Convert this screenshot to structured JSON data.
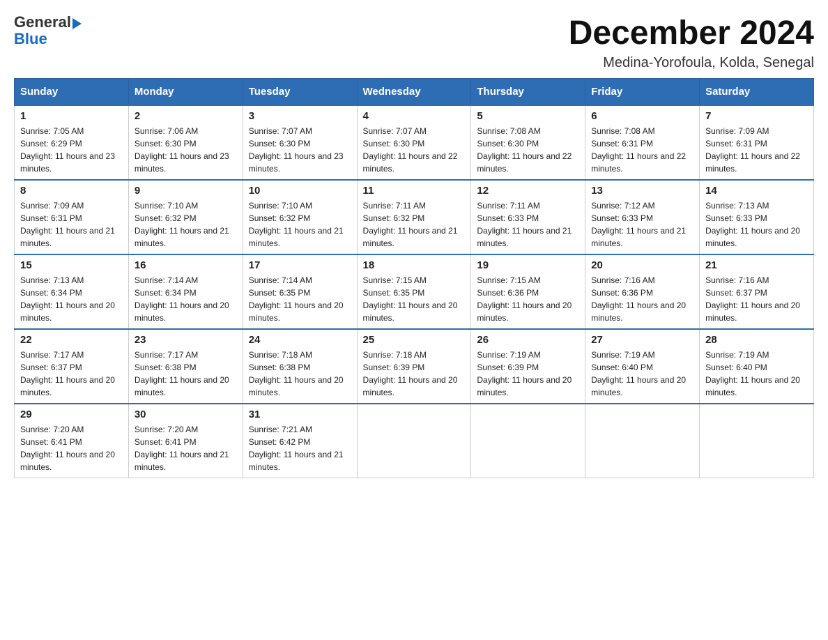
{
  "logo": {
    "text_general": "General",
    "text_blue": "Blue"
  },
  "header": {
    "month_title": "December 2024",
    "location": "Medina-Yorofoula, Kolda, Senegal"
  },
  "days_of_week": [
    "Sunday",
    "Monday",
    "Tuesday",
    "Wednesday",
    "Thursday",
    "Friday",
    "Saturday"
  ],
  "weeks": [
    [
      {
        "day": "1",
        "sunrise": "7:05 AM",
        "sunset": "6:29 PM",
        "daylight": "11 hours and 23 minutes."
      },
      {
        "day": "2",
        "sunrise": "7:06 AM",
        "sunset": "6:30 PM",
        "daylight": "11 hours and 23 minutes."
      },
      {
        "day": "3",
        "sunrise": "7:07 AM",
        "sunset": "6:30 PM",
        "daylight": "11 hours and 23 minutes."
      },
      {
        "day": "4",
        "sunrise": "7:07 AM",
        "sunset": "6:30 PM",
        "daylight": "11 hours and 22 minutes."
      },
      {
        "day": "5",
        "sunrise": "7:08 AM",
        "sunset": "6:30 PM",
        "daylight": "11 hours and 22 minutes."
      },
      {
        "day": "6",
        "sunrise": "7:08 AM",
        "sunset": "6:31 PM",
        "daylight": "11 hours and 22 minutes."
      },
      {
        "day": "7",
        "sunrise": "7:09 AM",
        "sunset": "6:31 PM",
        "daylight": "11 hours and 22 minutes."
      }
    ],
    [
      {
        "day": "8",
        "sunrise": "7:09 AM",
        "sunset": "6:31 PM",
        "daylight": "11 hours and 21 minutes."
      },
      {
        "day": "9",
        "sunrise": "7:10 AM",
        "sunset": "6:32 PM",
        "daylight": "11 hours and 21 minutes."
      },
      {
        "day": "10",
        "sunrise": "7:10 AM",
        "sunset": "6:32 PM",
        "daylight": "11 hours and 21 minutes."
      },
      {
        "day": "11",
        "sunrise": "7:11 AM",
        "sunset": "6:32 PM",
        "daylight": "11 hours and 21 minutes."
      },
      {
        "day": "12",
        "sunrise": "7:11 AM",
        "sunset": "6:33 PM",
        "daylight": "11 hours and 21 minutes."
      },
      {
        "day": "13",
        "sunrise": "7:12 AM",
        "sunset": "6:33 PM",
        "daylight": "11 hours and 21 minutes."
      },
      {
        "day": "14",
        "sunrise": "7:13 AM",
        "sunset": "6:33 PM",
        "daylight": "11 hours and 20 minutes."
      }
    ],
    [
      {
        "day": "15",
        "sunrise": "7:13 AM",
        "sunset": "6:34 PM",
        "daylight": "11 hours and 20 minutes."
      },
      {
        "day": "16",
        "sunrise": "7:14 AM",
        "sunset": "6:34 PM",
        "daylight": "11 hours and 20 minutes."
      },
      {
        "day": "17",
        "sunrise": "7:14 AM",
        "sunset": "6:35 PM",
        "daylight": "11 hours and 20 minutes."
      },
      {
        "day": "18",
        "sunrise": "7:15 AM",
        "sunset": "6:35 PM",
        "daylight": "11 hours and 20 minutes."
      },
      {
        "day": "19",
        "sunrise": "7:15 AM",
        "sunset": "6:36 PM",
        "daylight": "11 hours and 20 minutes."
      },
      {
        "day": "20",
        "sunrise": "7:16 AM",
        "sunset": "6:36 PM",
        "daylight": "11 hours and 20 minutes."
      },
      {
        "day": "21",
        "sunrise": "7:16 AM",
        "sunset": "6:37 PM",
        "daylight": "11 hours and 20 minutes."
      }
    ],
    [
      {
        "day": "22",
        "sunrise": "7:17 AM",
        "sunset": "6:37 PM",
        "daylight": "11 hours and 20 minutes."
      },
      {
        "day": "23",
        "sunrise": "7:17 AM",
        "sunset": "6:38 PM",
        "daylight": "11 hours and 20 minutes."
      },
      {
        "day": "24",
        "sunrise": "7:18 AM",
        "sunset": "6:38 PM",
        "daylight": "11 hours and 20 minutes."
      },
      {
        "day": "25",
        "sunrise": "7:18 AM",
        "sunset": "6:39 PM",
        "daylight": "11 hours and 20 minutes."
      },
      {
        "day": "26",
        "sunrise": "7:19 AM",
        "sunset": "6:39 PM",
        "daylight": "11 hours and 20 minutes."
      },
      {
        "day": "27",
        "sunrise": "7:19 AM",
        "sunset": "6:40 PM",
        "daylight": "11 hours and 20 minutes."
      },
      {
        "day": "28",
        "sunrise": "7:19 AM",
        "sunset": "6:40 PM",
        "daylight": "11 hours and 20 minutes."
      }
    ],
    [
      {
        "day": "29",
        "sunrise": "7:20 AM",
        "sunset": "6:41 PM",
        "daylight": "11 hours and 20 minutes."
      },
      {
        "day": "30",
        "sunrise": "7:20 AM",
        "sunset": "6:41 PM",
        "daylight": "11 hours and 21 minutes."
      },
      {
        "day": "31",
        "sunrise": "7:21 AM",
        "sunset": "6:42 PM",
        "daylight": "11 hours and 21 minutes."
      },
      null,
      null,
      null,
      null
    ]
  ]
}
